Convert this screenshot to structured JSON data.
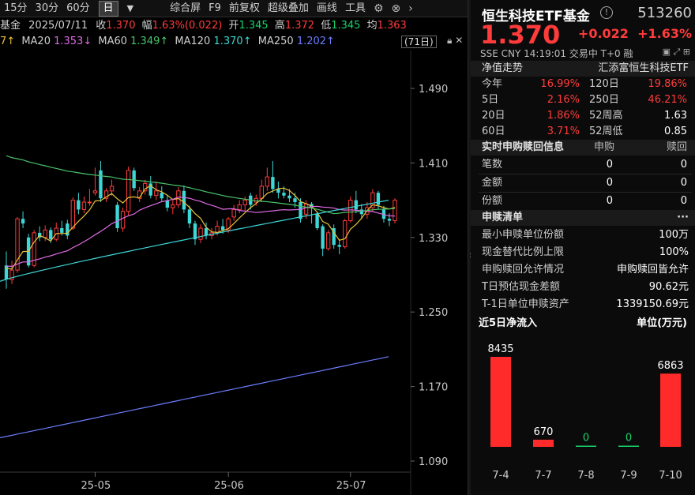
{
  "toolbar": {
    "periods": [
      "15分",
      "30分",
      "60分",
      "日"
    ],
    "selected_period": "日",
    "items": [
      "综合屏",
      "F9",
      "前复权",
      "超级叠加",
      "画线",
      "工具"
    ]
  },
  "infoline": {
    "name_fragment": "基金",
    "date": "2025/07/11",
    "close_label": "收",
    "close": "1.370",
    "amp_label": "幅",
    "amp": "1.63%(0.022)",
    "open_label": "开",
    "open": "1.345",
    "high_label": "高",
    "high": "1.372",
    "low_label": "低",
    "low": "1.345",
    "avg_label": "均",
    "avg": "1.363"
  },
  "ma": {
    "ma5_value_fragment": "7↑",
    "ma20_label": "MA20",
    "ma20": "1.353↓",
    "ma60_label": "MA60",
    "ma60": "1.349↑",
    "ma120_label": "MA120",
    "ma120": "1.370↑",
    "ma250_label": "MA250",
    "ma250": "1.202↑",
    "days_badge": "(71日)"
  },
  "chart_data": {
    "type": "candlestick",
    "y_ticks": [
      "1.490",
      "1.410",
      "1.330",
      "1.250",
      "1.170",
      "1.090"
    ],
    "x_ticks": [
      "25-05",
      "25-06",
      "25-07"
    ],
    "ylim": [
      1.09,
      1.49
    ],
    "candles": [
      [
        1.3,
        1.285,
        1.315,
        1.275
      ],
      [
        1.285,
        1.295,
        1.305,
        1.28
      ],
      [
        1.295,
        1.35,
        1.352,
        1.292
      ],
      [
        1.35,
        1.345,
        1.358,
        1.34
      ],
      [
        1.33,
        1.3,
        1.334,
        1.298
      ],
      [
        1.3,
        1.335,
        1.338,
        1.298
      ],
      [
        1.335,
        1.33,
        1.342,
        1.326
      ],
      [
        1.33,
        1.338,
        1.343,
        1.326
      ],
      [
        1.338,
        1.328,
        1.341,
        1.324
      ],
      [
        1.328,
        1.34,
        1.346,
        1.326
      ],
      [
        1.34,
        1.335,
        1.348,
        1.332
      ],
      [
        1.345,
        1.332,
        1.349,
        1.328
      ],
      [
        1.34,
        1.37,
        1.373,
        1.338
      ],
      [
        1.37,
        1.36,
        1.378,
        1.355
      ],
      [
        1.36,
        1.368,
        1.374,
        1.356
      ],
      [
        1.368,
        1.368,
        1.382,
        1.364
      ],
      [
        1.378,
        1.38,
        1.405,
        1.375
      ],
      [
        1.402,
        1.372,
        1.412,
        1.368
      ],
      [
        1.372,
        1.38,
        1.383,
        1.368
      ],
      [
        1.38,
        1.385,
        1.392,
        1.375
      ],
      [
        1.365,
        1.34,
        1.368,
        1.336
      ],
      [
        1.34,
        1.358,
        1.362,
        1.336
      ],
      [
        1.358,
        1.402,
        1.406,
        1.354
      ],
      [
        1.402,
        1.383,
        1.405,
        1.38
      ],
      [
        1.372,
        1.38,
        1.384,
        1.368
      ],
      [
        1.38,
        1.388,
        1.392,
        1.376
      ],
      [
        1.388,
        1.375,
        1.396,
        1.372
      ],
      [
        1.375,
        1.38,
        1.39,
        1.37
      ],
      [
        1.378,
        1.372,
        1.385,
        1.369
      ],
      [
        1.37,
        1.362,
        1.376,
        1.358
      ],
      [
        1.362,
        1.365,
        1.37,
        1.355
      ],
      [
        1.365,
        1.38,
        1.384,
        1.362
      ],
      [
        1.38,
        1.36,
        1.386,
        1.356
      ],
      [
        1.36,
        1.345,
        1.364,
        1.34
      ],
      [
        1.345,
        1.328,
        1.348,
        1.322
      ],
      [
        1.328,
        1.34,
        1.344,
        1.324
      ],
      [
        1.34,
        1.332,
        1.346,
        1.328
      ],
      [
        1.332,
        1.335,
        1.34,
        1.328
      ],
      [
        1.335,
        1.342,
        1.348,
        1.332
      ],
      [
        1.342,
        1.338,
        1.35,
        1.334
      ],
      [
        1.338,
        1.35,
        1.352,
        1.335
      ],
      [
        1.352,
        1.36,
        1.365,
        1.348
      ],
      [
        1.36,
        1.365,
        1.37,
        1.356
      ],
      [
        1.365,
        1.37,
        1.374,
        1.358
      ],
      [
        1.375,
        1.365,
        1.378,
        1.36
      ],
      [
        1.368,
        1.372,
        1.376,
        1.364
      ],
      [
        1.372,
        1.385,
        1.392,
        1.368
      ],
      [
        1.385,
        1.395,
        1.405,
        1.38
      ],
      [
        1.395,
        1.382,
        1.412,
        1.378
      ],
      [
        1.382,
        1.378,
        1.39,
        1.372
      ],
      [
        1.378,
        1.375,
        1.385,
        1.372
      ],
      [
        1.375,
        1.372,
        1.382,
        1.368
      ],
      [
        1.372,
        1.368,
        1.378,
        1.362
      ],
      [
        1.368,
        1.35,
        1.372,
        1.346
      ],
      [
        1.355,
        1.366,
        1.37,
        1.35
      ],
      [
        1.366,
        1.362,
        1.368,
        1.345
      ],
      [
        1.355,
        1.34,
        1.358,
        1.338
      ],
      [
        1.342,
        1.318,
        1.344,
        1.31
      ],
      [
        1.318,
        1.335,
        1.338,
        1.316
      ],
      [
        1.34,
        1.322,
        1.344,
        1.318
      ],
      [
        1.322,
        1.32,
        1.328,
        1.312
      ],
      [
        1.32,
        1.348,
        1.35,
        1.318
      ],
      [
        1.348,
        1.37,
        1.374,
        1.346
      ],
      [
        1.37,
        1.36,
        1.38,
        1.356
      ],
      [
        1.36,
        1.355,
        1.366,
        1.35
      ],
      [
        1.355,
        1.362,
        1.368,
        1.35
      ],
      [
        1.362,
        1.378,
        1.382,
        1.358
      ],
      [
        1.378,
        1.365,
        1.38,
        1.36
      ],
      [
        1.36,
        1.35,
        1.364,
        1.346
      ],
      [
        1.35,
        1.348,
        1.356,
        1.342
      ],
      [
        1.348,
        1.37,
        1.372,
        1.345
      ]
    ],
    "ma_series": [
      {
        "name": "MA5",
        "color": "#e8c23a"
      },
      {
        "name": "MA20",
        "color": "#e06be6"
      },
      {
        "name": "MA60",
        "color": "#49c46b"
      },
      {
        "name": "MA120",
        "color": "#3ed6d6"
      },
      {
        "name": "MA250",
        "color": "#6a7dff"
      }
    ]
  },
  "panel": {
    "title": "恒生科技ETF基金",
    "info_icon": "info-circle-icon",
    "code": "513260",
    "price": "1.370",
    "change": "+0.022",
    "change_pct": "+1.63%",
    "sub": "SSE  CNY  14:19:01  交易中  T+0  融",
    "nav_header": "净值走势",
    "nav_fund": "汇添富恒生科技ETF",
    "perf": [
      {
        "l1": "今年",
        "v1": "16.99%",
        "l2": "120日",
        "v2": "19.86%"
      },
      {
        "l1": "5日",
        "v1": "2.16%",
        "l2": "250日",
        "v2": "46.21%"
      },
      {
        "l1": "20日",
        "v1": "1.86%",
        "l2": "52周高",
        "v2": "1.63"
      },
      {
        "l1": "60日",
        "v1": "3.71%",
        "l2": "52周低",
        "v2": "0.85"
      }
    ],
    "realtime_header": "实时申购赎回信息",
    "realtime_col1": "申购",
    "realtime_col2": "赎回",
    "realtime": [
      {
        "label": "笔数",
        "a": "0",
        "b": "0"
      },
      {
        "label": "金额",
        "a": "0",
        "b": "0"
      },
      {
        "label": "份额",
        "a": "0",
        "b": "0"
      }
    ],
    "list_header": "申赎清单",
    "list_more": "···",
    "list": [
      {
        "label": "最小申赎单位份额",
        "value": "100万"
      },
      {
        "label": "现金替代比例上限",
        "value": "100%"
      },
      {
        "label": "申购赎回允许情况",
        "value": "申购赎回皆允许"
      },
      {
        "label": "T日预估现金差额",
        "value": "90.62元"
      },
      {
        "label": "T-1日单位申赎资产",
        "value": "1339150.69元"
      }
    ],
    "flow_title": "近5日净流入",
    "flow_unit": "单位(万元)"
  },
  "flow_data": {
    "type": "bar",
    "categories": [
      "7-4",
      "7-7",
      "7-8",
      "7-9",
      "7-10"
    ],
    "values": [
      8435,
      670,
      0,
      0,
      6863
    ],
    "labels": [
      "8435",
      "670",
      "0",
      "0",
      "6863"
    ],
    "bar_color": "#ff2a2a",
    "zero_label_color": "#19d36a"
  }
}
